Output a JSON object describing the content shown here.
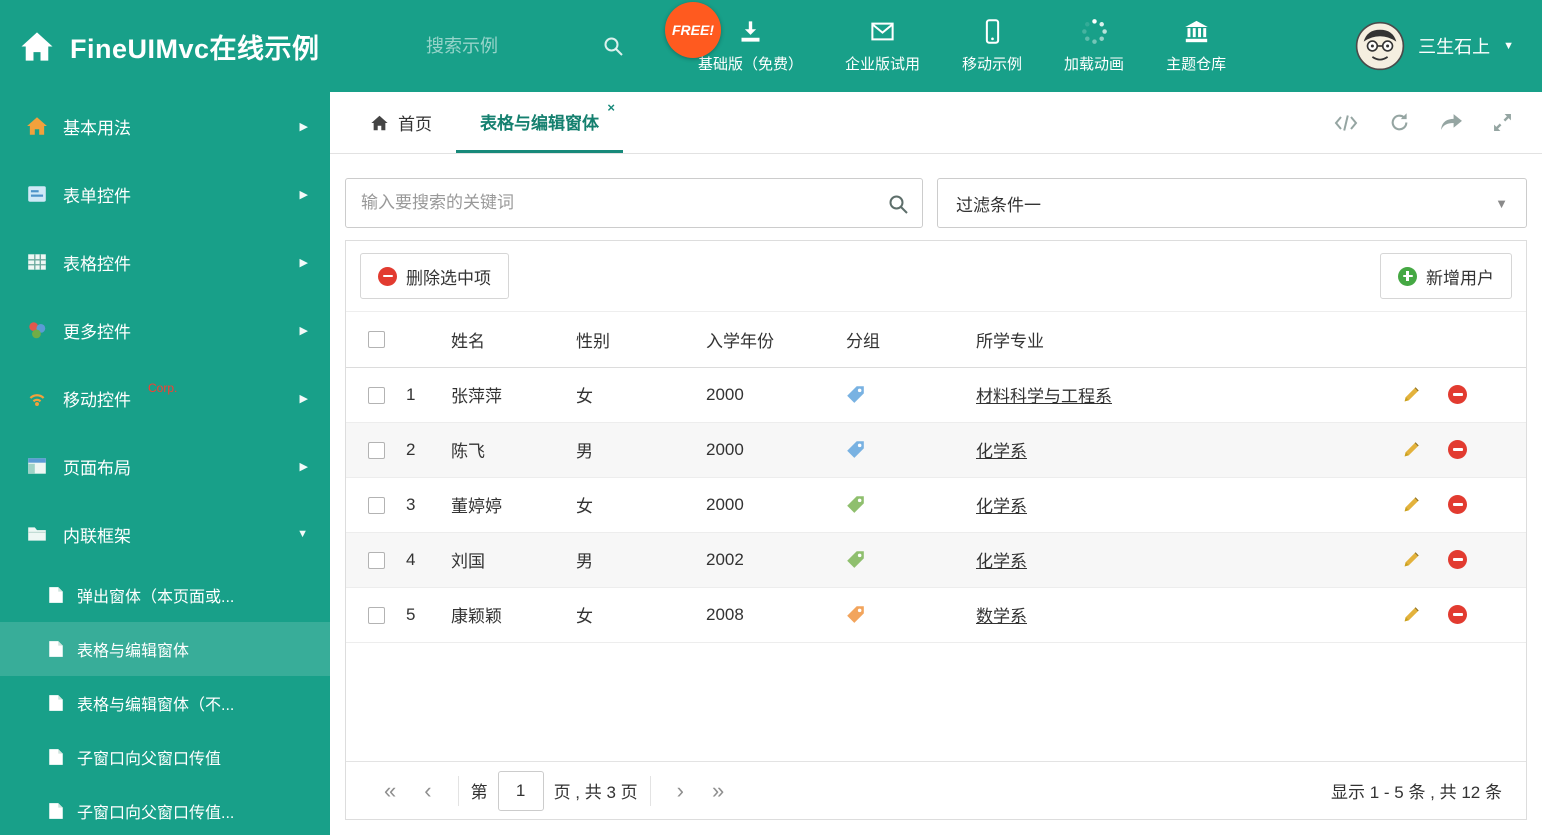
{
  "colors": {
    "theme_green": "#18a089",
    "active_tab_teal": "#17897a",
    "free_badge_orange": "#ff5a1f",
    "delete_red": "#e23b30",
    "add_green": "#45a843",
    "edit_yellow": "#e3b23c"
  },
  "header": {
    "title": "FineUIMvc在线示例",
    "search_placeholder": "搜索示例",
    "free_badge": "FREE!",
    "nav": [
      {
        "label": "基础版（免费）",
        "icon": "download-icon"
      },
      {
        "label": "企业版试用",
        "icon": "envelope-icon"
      },
      {
        "label": "移动示例",
        "icon": "mobile-icon"
      },
      {
        "label": "加载动画",
        "icon": "spinner-icon"
      },
      {
        "label": "主题仓库",
        "icon": "bank-icon"
      }
    ],
    "user_name": "三生石上"
  },
  "sidebar": {
    "items": [
      {
        "label": "基本用法",
        "icon": "home-icon"
      },
      {
        "label": "表单控件",
        "icon": "form-icon"
      },
      {
        "label": "表格控件",
        "icon": "table-icon"
      },
      {
        "label": "更多控件",
        "icon": "widgets-icon"
      },
      {
        "label": "移动控件",
        "badge": "Corp.",
        "icon": "signal-icon"
      },
      {
        "label": "页面布局",
        "icon": "layout-icon"
      },
      {
        "label": "内联框架",
        "icon": "frame-icon",
        "expanded": true
      }
    ],
    "subitems": [
      {
        "label": "弹出窗体（本页面或..."
      },
      {
        "label": "表格与编辑窗体",
        "active": true
      },
      {
        "label": "表格与编辑窗体（不..."
      },
      {
        "label": "子窗口向父窗口传值"
      },
      {
        "label": "子窗口向父窗口传值..."
      }
    ]
  },
  "tabs": {
    "home": {
      "label": "首页"
    },
    "active": {
      "label": "表格与编辑窗体"
    }
  },
  "filter": {
    "search_placeholder": "输入要搜索的关键词",
    "dropdown_value": "过滤条件一"
  },
  "toolbar": {
    "delete_label": "删除选中项",
    "add_label": "新增用户"
  },
  "table": {
    "columns": {
      "name": "姓名",
      "gender": "性别",
      "year": "入学年份",
      "group": "分组",
      "major": "所学专业"
    },
    "rows": [
      {
        "index": 1,
        "name": "张萍萍",
        "gender": "女",
        "year": 2000,
        "tag_color": "#79b2e2",
        "major": "材料科学与工程系"
      },
      {
        "index": 2,
        "name": "陈飞",
        "gender": "男",
        "year": 2000,
        "tag_color": "#79b2e2",
        "major": "化学系"
      },
      {
        "index": 3,
        "name": "董婷婷",
        "gender": "女",
        "year": 2000,
        "tag_color": "#8fbf6e",
        "major": "化学系"
      },
      {
        "index": 4,
        "name": "刘国",
        "gender": "男",
        "year": 2002,
        "tag_color": "#8fbf6e",
        "major": "化学系"
      },
      {
        "index": 5,
        "name": "康颖颖",
        "gender": "女",
        "year": 2008,
        "tag_color": "#f2a45c",
        "major": "数学系"
      }
    ]
  },
  "pagination": {
    "prefix": "第",
    "page": "1",
    "suffix": "页 , 共 3 页",
    "summary": "显示 1 - 5 条 , 共 12 条"
  }
}
